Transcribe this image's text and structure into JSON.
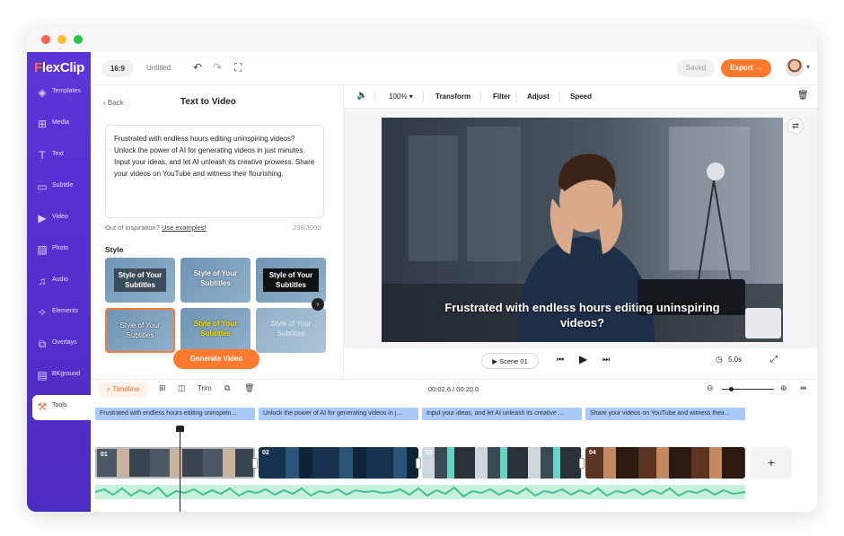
{
  "window": {
    "dots": [
      "#ff5f57",
      "#febc2e",
      "#28c840"
    ]
  },
  "app": {
    "logo": "FlexClip"
  },
  "sidebar": {
    "items": [
      {
        "label": "Templates",
        "icon": "layers-icon",
        "glyph": "◈"
      },
      {
        "label": "Media",
        "icon": "media-icon",
        "glyph": "⊞"
      },
      {
        "label": "Text",
        "icon": "text-icon",
        "glyph": "T"
      },
      {
        "label": "Subtitle",
        "icon": "subtitle-icon",
        "glyph": "▭"
      },
      {
        "label": "Video",
        "icon": "video-icon",
        "glyph": "▶"
      },
      {
        "label": "Photo",
        "icon": "photo-icon",
        "glyph": "▨"
      },
      {
        "label": "Audio",
        "icon": "audio-icon",
        "glyph": "♫"
      },
      {
        "label": "Elements",
        "icon": "elements-icon",
        "glyph": "✧"
      },
      {
        "label": "Overlays",
        "icon": "overlays-icon",
        "glyph": "⧉"
      },
      {
        "label": "BKground",
        "icon": "background-icon",
        "glyph": "▤"
      },
      {
        "label": "Tools",
        "icon": "tools-icon",
        "glyph": "⚒"
      }
    ],
    "active": "Tools"
  },
  "topbar": {
    "ratio": "16:9",
    "project_name": "Untitled",
    "saved_label": "Saved",
    "export_label": "Export →"
  },
  "panel": {
    "back_label": "Back",
    "title": "Text to Video",
    "script_text": "Frustrated with endless hours editing uninspiring videos? Unlock the power of AI for generating videos in just minutes. Input your ideas, and let AI unleash its creative prowess. Share your videos on YouTube and witness their flourishing.",
    "inspiration_prefix": "Out of inspiration?",
    "inspiration_link": "Use examples!",
    "char_count": "238/3000",
    "style_label": "Style",
    "style_cards": [
      "Style of Your Subtitles",
      "Style of Your Subtitles",
      "Style of Your Subtitles",
      "Style of Your Subtitles",
      "Style of Your Subtitles",
      "Style of Your Subtitles"
    ],
    "generate_label": "Generate Video"
  },
  "editbar": {
    "zoom": "100%",
    "transform": "Transform",
    "filter": "Filter",
    "adjust": "Adjust",
    "speed": "Speed"
  },
  "preview": {
    "subtitle": "Frustrated with endless hours editing uninspiring videos?"
  },
  "controls": {
    "scene": "Scene 01",
    "duration": "5.0s"
  },
  "timeline": {
    "tab": "Timeline",
    "trim": "Trim",
    "time": "00:02.6 / 00:20.0",
    "subtitles": [
      "Frustrated with endless hours editing uninspirin...",
      "Unlock the power of AI for generating videos in j...",
      "Input your ideas, and let AI unleash its creative ...",
      "Share your videos on YouTube and witness their..."
    ],
    "clips": [
      "01",
      "02",
      "03",
      "04"
    ],
    "add_label": "+"
  }
}
